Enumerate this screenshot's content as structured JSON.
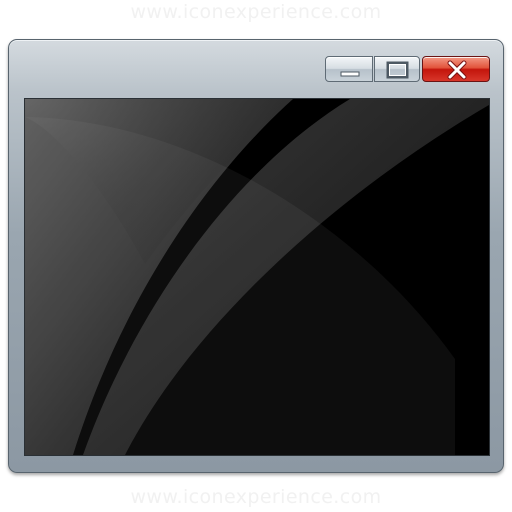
{
  "watermark": {
    "top_text": "www.iconexperience.com",
    "bottom_text": "www.iconexperience.com"
  },
  "window": {
    "controls": {
      "minimize_icon": "minimize-icon",
      "maximize_icon": "maximize-icon",
      "close_icon": "close-icon"
    },
    "colors": {
      "frame": "#9aa6b0",
      "close_button": "#d3261b",
      "content_background": "#000000"
    }
  }
}
